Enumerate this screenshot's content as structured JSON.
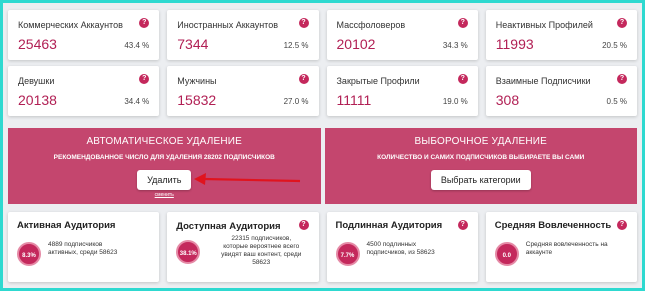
{
  "stats_row1": [
    {
      "label": "Коммерческих Аккаунтов",
      "value": "25463",
      "percent": "43.4 %"
    },
    {
      "label": "Иностранных Аккаунтов",
      "value": "7344",
      "percent": "12.5 %"
    },
    {
      "label": "Массфоловеров",
      "value": "20102",
      "percent": "34.3 %"
    },
    {
      "label": "Неактивных Профилей",
      "value": "11993",
      "percent": "20.5 %"
    }
  ],
  "stats_row2": [
    {
      "label": "Девушки",
      "value": "20138",
      "percent": "34.4 %"
    },
    {
      "label": "Мужчины",
      "value": "15832",
      "percent": "27.0 %"
    },
    {
      "label": "Закрытые Профили",
      "value": "11111",
      "percent": "19.0 %"
    },
    {
      "label": "Взаимные Подписчики",
      "value": "308",
      "percent": "0.5 %"
    }
  ],
  "help_glyph": "?",
  "auto_delete": {
    "title": "АВТОМАТИЧЕСКОЕ УДАЛЕНИЕ",
    "subtitle": "РЕКОМЕНДОВАННОЕ ЧИСЛО ДЛЯ УДАЛЕНИЯ 28202 ПОДПИСЧИКОВ",
    "button": "Удалить",
    "link": "сменить"
  },
  "selective_delete": {
    "title": "ВЫБОРОЧНОЕ УДАЛЕНИЕ",
    "subtitle": "КОЛИЧЕСТВО И САМИХ ПОДПИСЧИКОВ ВЫБИРАЕТЕ ВЫ САМИ",
    "button": "Выбрать категории"
  },
  "audience": [
    {
      "title": "Активная Аудитория",
      "percent": "8.3%",
      "desc": "4889 подписчиков\nактивных, среди 58623"
    },
    {
      "title": "Доступная Аудитория",
      "percent": "38.1%",
      "desc": "22315 подписчиков,\nкоторые вероятнее всего\nувидят ваш контент, среди\n58623"
    },
    {
      "title": "Подлинная Аудитория",
      "percent": "7.7%",
      "desc": "4500 подлинных\nподписчиков, из 58623"
    },
    {
      "title": "Средняя Вовлеченность",
      "percent": "0.0",
      "desc": "Средняя вовлеченность на\nаккаунте"
    }
  ],
  "colors": {
    "accent": "#c4285c",
    "banner": "#c4466e",
    "frame": "#2ed9d0",
    "arrow": "#e0141e"
  }
}
